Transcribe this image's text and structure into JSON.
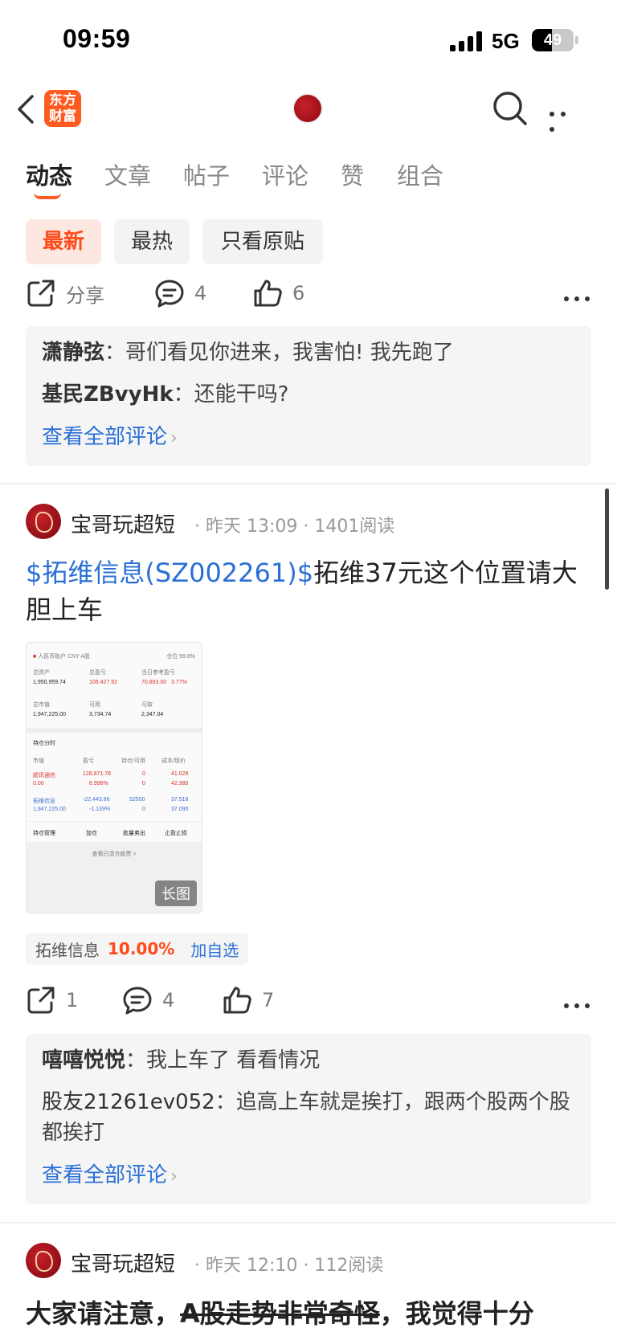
{
  "status": {
    "time": "09:59",
    "network": "5G",
    "battery": "49",
    "battery_level": 0.49
  },
  "nav": {
    "logo_line1": "东方",
    "logo_line2": "财富"
  },
  "tabs": [
    {
      "label": "动态"
    },
    {
      "label": "文章"
    },
    {
      "label": "帖子"
    },
    {
      "label": "评论"
    },
    {
      "label": "赞"
    },
    {
      "label": "组合"
    }
  ],
  "filters": [
    {
      "label": "最新"
    },
    {
      "label": "最热"
    },
    {
      "label": "只看原贴"
    }
  ],
  "post1": {
    "share_label": "分享",
    "comment_count": "4",
    "like_count": "6",
    "comments": [
      {
        "author": "潇静弦",
        "sep": "：",
        "text": "哥们看见你进来，我害怕! 我先跑了"
      },
      {
        "author": "基民ZBvyHk",
        "sep": "：",
        "text": "还能干吗?"
      }
    ],
    "view_all": "查看全部评论"
  },
  "post2": {
    "author": "宝哥玩超短",
    "meta_dot": "·",
    "time": "昨天 13:09",
    "reads": "1401阅读",
    "title_link": "$拓维信息(SZ002261)$",
    "title_text": "拓维37元这个位置请大胆上车",
    "image_badge": "长图",
    "screenshot": {
      "header": "人民币账户 CNY A股",
      "position": "仓位 99.8%",
      "total_assets_label": "总资产",
      "total_pnl_label": "总盈亏",
      "daily_pnl_label": "当日参考盈亏",
      "total_assets": "1,950,959.74",
      "total_pnl": "106,427.92",
      "daily_pnl": "70,893.00",
      "daily_pct": "3.77%",
      "market_value_label": "总市值",
      "available_label": "可用",
      "withdrawable_label": "可取",
      "market_value": "1,947,225.00",
      "available": "3,734.74",
      "withdrawable": "2,347.04",
      "section": "持仓分时",
      "col1": "市值",
      "col2": "盈亏",
      "col3": "持仓/可用",
      "col4": "成本/现价",
      "row1_name": "超讯通信",
      "row1_pnl": "128,871.78",
      "row1_qty": "0",
      "row1_price": "41.029",
      "row1_mv": "0.00",
      "row1_pct": "6.996%",
      "row1_avail": "0",
      "row1_now": "42.380",
      "row2_name": "拓维信息",
      "row2_pnl": "-22,443.86",
      "row2_qty": "52500",
      "row2_price": "37.518",
      "row2_mv": "1,947,225.00",
      "row2_pct": "-1.139%",
      "row2_avail": "0",
      "row2_now": "37.090",
      "btn1": "持仓管理",
      "btn2": "加仓",
      "btn3": "批量卖出",
      "btn4": "止盈止损",
      "footer": "查看已清仓股票 >"
    },
    "stock_tag": {
      "name": "拓维信息",
      "change": "10.00%",
      "add": "加自选"
    },
    "share_count": "1",
    "comment_count": "4",
    "like_count": "7",
    "comments": [
      {
        "author": "嘻嘻悦悦",
        "sep": "：",
        "text": "我上车了 看看情况"
      },
      {
        "author": "股友21261ev052",
        "sep": "：",
        "text": "追高上车就是挨打，跟两个股两个股都挨打"
      }
    ],
    "view_all": "查看全部评论"
  },
  "post3": {
    "author": "宝哥玩超短",
    "meta_dot": "·",
    "time": "昨天 12:10",
    "reads": "112阅读",
    "title_a": "大家请注意，",
    "title_strike": "A股走势非常奇怪",
    "title_b": "，我觉得十分"
  },
  "colors": {
    "accent": "#ff5a1f",
    "link": "#2a6fd6",
    "rise": "#ff4a1a"
  }
}
